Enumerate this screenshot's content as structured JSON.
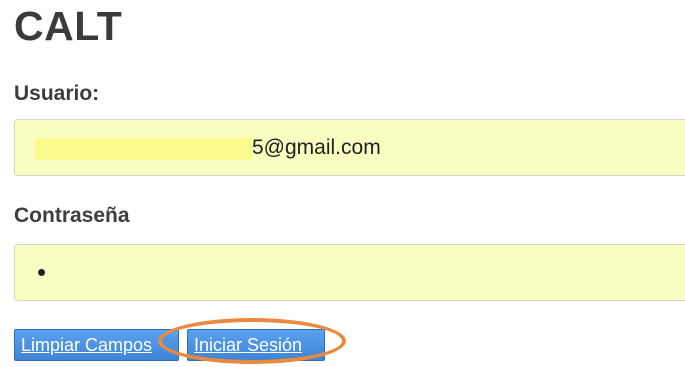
{
  "header": {
    "title": "CALT"
  },
  "form": {
    "user_label": "Usuario:",
    "user_value": "5@gmail.com",
    "password_label": "Contraseña",
    "password_value": "•"
  },
  "buttons": {
    "clear_label": "Limpiar Campos",
    "login_label": "Iniciar Sesión"
  },
  "colors": {
    "input_bg": "#fafdc0",
    "button_bg": "#4a90e2",
    "highlight": "#ea8a3e"
  }
}
